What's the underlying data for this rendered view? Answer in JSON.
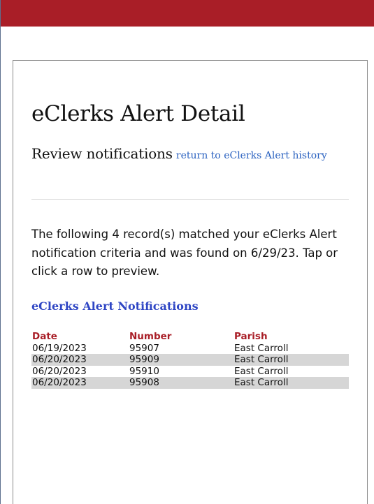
{
  "header": {
    "title": "eClerks Alert Detail",
    "subtitle": "Review notifications",
    "return_link": "return to eClerks Alert history"
  },
  "intro": "The following 4 record(s) matched your eClerks Alert notification criteria and was found on 6/29/23. Tap or click a row to preview.",
  "notifications": {
    "title": "eClerks Alert Notifications",
    "columns": [
      "Date",
      "Number",
      "Parish"
    ],
    "rows": [
      {
        "date": "06/19/2023",
        "number": "95907",
        "parish": "East Carroll"
      },
      {
        "date": "06/20/2023",
        "number": "95909",
        "parish": "East Carroll"
      },
      {
        "date": "06/20/2023",
        "number": "95910",
        "parish": "East Carroll"
      },
      {
        "date": "06/20/2023",
        "number": "95908",
        "parish": "East Carroll"
      }
    ]
  },
  "colors": {
    "top_bar": "#a91e27",
    "link": "#2b62c0",
    "section_title": "#2f46c4",
    "table_header": "#a91e27",
    "row_shade": "#d6d6d6"
  }
}
